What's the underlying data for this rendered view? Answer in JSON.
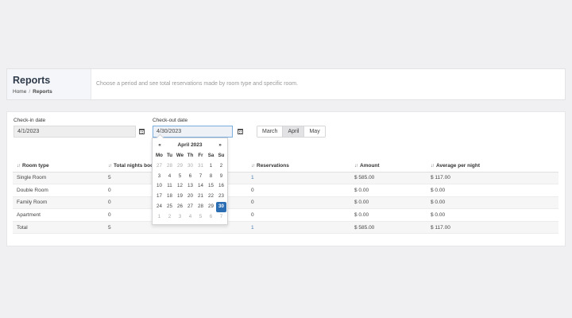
{
  "header": {
    "title": "Reports",
    "breadcrumb": {
      "home": "Home",
      "separator": "/",
      "current": "Reports"
    },
    "description": "Choose a period and see total reservations made by room type and specific room."
  },
  "filters": {
    "checkin_label": "Check-in date",
    "checkin_value": "4/1/2023",
    "checkout_label": "Check-out date",
    "checkout_value": "4/30/2023",
    "months": [
      {
        "label": "March",
        "active": false
      },
      {
        "label": "April",
        "active": true
      },
      {
        "label": "May",
        "active": false
      }
    ]
  },
  "table": {
    "columns": [
      "Room type",
      "Total nights booked",
      "Reservations",
      "Amount",
      "Average per night"
    ],
    "rows": [
      {
        "room_type": "Single Room",
        "nights": "5",
        "reservations": "1",
        "amount": "$ 585.00",
        "avg": "$ 117.00"
      },
      {
        "room_type": "Double Room",
        "nights": "0",
        "reservations": "0",
        "amount": "$ 0.00",
        "avg": "$ 0.00"
      },
      {
        "room_type": "Family Room",
        "nights": "0",
        "reservations": "0",
        "amount": "$ 0.00",
        "avg": "$ 0.00"
      },
      {
        "room_type": "Apartment",
        "nights": "0",
        "reservations": "0",
        "amount": "$ 0.00",
        "avg": "$ 0.00"
      },
      {
        "room_type": "Total",
        "nights": "5",
        "reservations": "1",
        "amount": "$ 585.00",
        "avg": "$ 117.00"
      }
    ]
  },
  "datepicker": {
    "prev": "«",
    "next": "»",
    "title": "April 2023",
    "weekdays": [
      "Mo",
      "Tu",
      "We",
      "Th",
      "Fr",
      "Sa",
      "Su"
    ],
    "weeks": [
      [
        "27",
        "28",
        "29",
        "30",
        "31",
        "1",
        "2"
      ],
      [
        "3",
        "4",
        "5",
        "6",
        "7",
        "8",
        "9"
      ],
      [
        "10",
        "11",
        "12",
        "13",
        "14",
        "15",
        "16"
      ],
      [
        "17",
        "18",
        "19",
        "20",
        "21",
        "22",
        "23"
      ],
      [
        "24",
        "25",
        "26",
        "27",
        "28",
        "29",
        "30"
      ],
      [
        "1",
        "2",
        "3",
        "4",
        "5",
        "6",
        "7"
      ]
    ],
    "selected": "30"
  },
  "colors": {
    "accent": "#2c6eb3",
    "link": "#4a7bb0",
    "background": "#f0f0f2"
  }
}
